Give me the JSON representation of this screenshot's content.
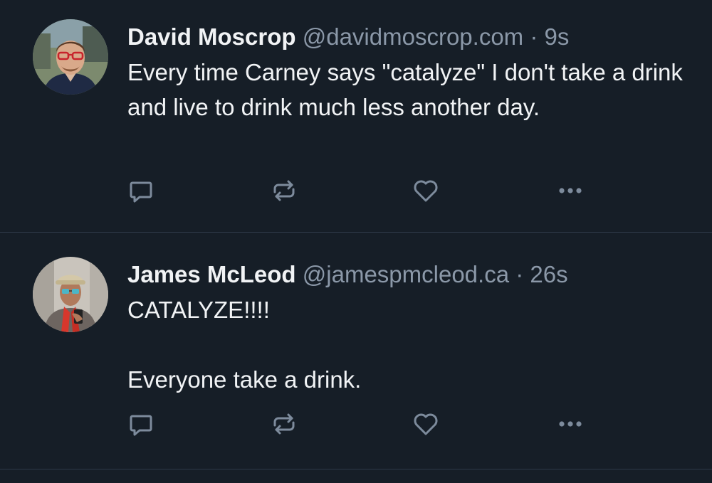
{
  "posts": [
    {
      "author": {
        "display_name": "David Moscrop",
        "handle": "@davidmoscrop.com",
        "avatar_icon": "avatar-man-glasses"
      },
      "separator": "·",
      "time": "9s",
      "text": "Every time Carney says \"catalyze\" I don't take a drink and live to drink much less another day.",
      "actions": [
        "reply-icon",
        "repost-icon",
        "like-icon",
        "more-icon"
      ]
    },
    {
      "author": {
        "display_name": "James McLeod",
        "handle": "@jamespmcleod.ca",
        "avatar_icon": "avatar-man-hat-scarf"
      },
      "separator": "·",
      "time": "26s",
      "text": "CATALYZE!!!!\n\nEveryone take a drink.",
      "actions": [
        "reply-icon",
        "repost-icon",
        "like-icon",
        "more-icon"
      ]
    }
  ],
  "colors": {
    "background": "#161e27",
    "text": "#f1f3f5",
    "muted": "#8b98a8",
    "divider": "#2e3a48",
    "icon": "#7d8b9c"
  }
}
